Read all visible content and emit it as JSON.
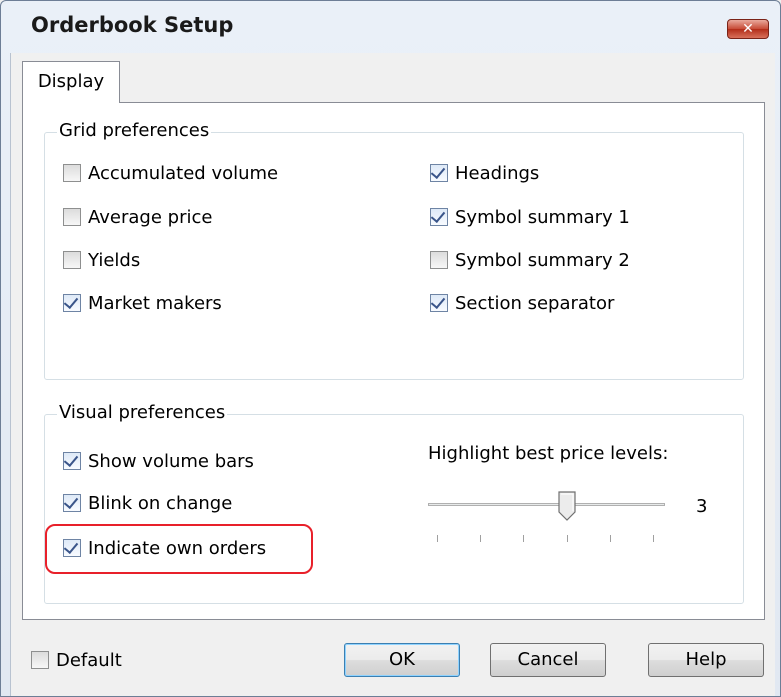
{
  "window": {
    "title": "Orderbook Setup",
    "close_label": "✕"
  },
  "tabs": [
    {
      "label": "Display",
      "selected": true
    }
  ],
  "grid_preferences": {
    "title": "Grid preferences",
    "left": [
      {
        "label": "Accumulated volume",
        "checked": false
      },
      {
        "label": "Average price",
        "checked": false
      },
      {
        "label": "Yields",
        "checked": false
      },
      {
        "label": "Market makers",
        "checked": true
      }
    ],
    "right": [
      {
        "label": "Headings",
        "checked": true
      },
      {
        "label": "Symbol summary 1",
        "checked": true
      },
      {
        "label": "Symbol summary 2",
        "checked": false
      },
      {
        "label": "Section separator",
        "checked": true
      }
    ]
  },
  "visual_preferences": {
    "title": "Visual preferences",
    "items": [
      {
        "label": "Show volume bars",
        "checked": true
      },
      {
        "label": "Blink on change",
        "checked": true
      },
      {
        "label": "Indicate own orders",
        "checked": true
      }
    ],
    "highlight": {
      "label": "Highlight best price levels:",
      "value": 3,
      "value_text": "3",
      "min": 0,
      "max": 5
    }
  },
  "footer": {
    "default": {
      "label": "Default",
      "checked": false
    },
    "ok_label": "OK",
    "cancel_label": "Cancel",
    "help_label": "Help"
  },
  "colors": {
    "highlight_ring": "#e8202a",
    "close_button": "#c74a35"
  }
}
